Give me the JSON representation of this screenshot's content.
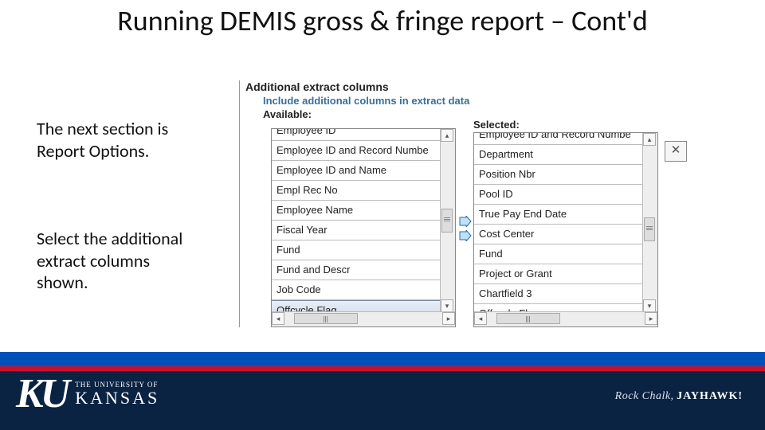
{
  "title": "Running DEMIS gross & fringe report – Cont'd",
  "paragraphs": {
    "p1": "The next section is Report Options.",
    "p2": "Select the additional extract columns shown."
  },
  "panel": {
    "heading": "Additional extract columns",
    "subheading": "Include additional columns in extract data",
    "available_label": "Available:",
    "selected_label": "Selected:"
  },
  "available": [
    "Employee ID",
    "Employee ID and Record Numbe",
    "Employee ID and Name",
    "Empl Rec No",
    "Employee Name",
    "Fiscal Year",
    "Fund",
    "Fund and Descr",
    "Job Code",
    "Offcycle Flag"
  ],
  "selected": [
    "Employee ID and Record Numbe",
    "Department",
    "Position Nbr",
    "Pool ID",
    "True Pay End Date",
    "Cost Center",
    "Fund",
    "Project or Grant",
    "Chartfield 3",
    "Offcycle Flag"
  ],
  "available_highlight_index": 9,
  "remove_button": "✕",
  "scroll_glyphs": {
    "up": "▴",
    "down": "▾",
    "left": "◂",
    "right": "▸"
  },
  "footer": {
    "univ_small": "THE UNIVERSITY OF",
    "univ_big": "KANSAS",
    "tag_italic": "Rock Chalk,",
    "tag_bold": "JAYHAWK!"
  }
}
